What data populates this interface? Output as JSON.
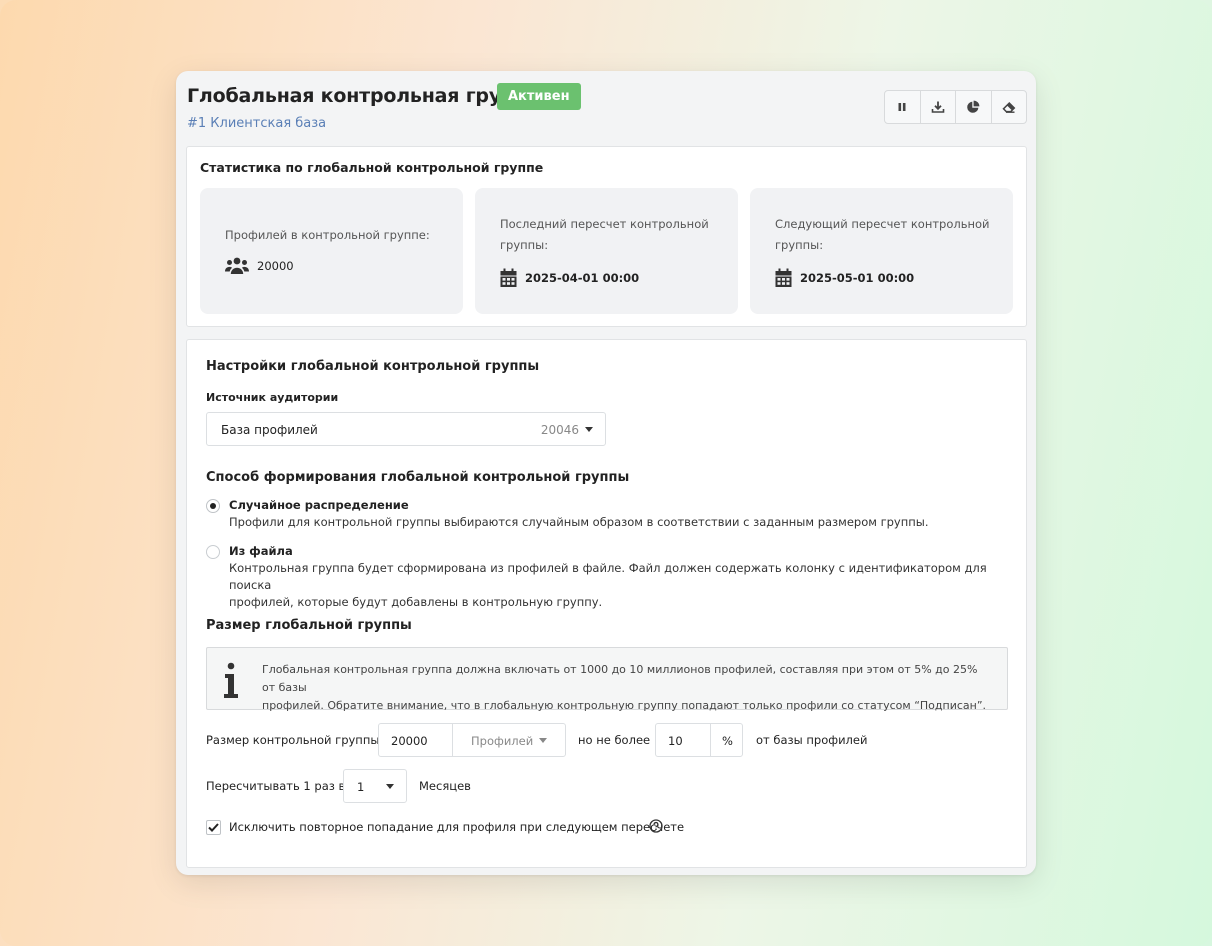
{
  "header": {
    "title": "Глобальная контрольная группа",
    "status": "Активен",
    "subtitle": "#1 Клиентская база",
    "toolbar": [
      "pause-icon",
      "download-icon",
      "pie-chart-icon",
      "eraser-icon"
    ]
  },
  "stats": {
    "title": "Статистика по глобальной контрольной группе",
    "cards": [
      {
        "label": "Профилей в контрольной группе:",
        "value": "20000",
        "icon": "users-icon"
      },
      {
        "label_line1": "Последний пересчет контрольной",
        "label_line2": "группы:",
        "value": "2025-04-01 00:00",
        "icon": "calendar-icon"
      },
      {
        "label_line1": "Следующий пересчет контрольной",
        "label_line2": "группы:",
        "value": "2025-05-01 00:00",
        "icon": "calendar-icon"
      }
    ]
  },
  "settings": {
    "title": "Настройки глобальной контрольной группы",
    "source_label": "Источник аудитории",
    "source_value": "База профилей",
    "source_count": "20046",
    "method_title": "Способ формирования глобальной контрольной группы",
    "options": [
      {
        "title": "Случайное распределение",
        "desc": "Профили для контрольной группы выбираются случайным образом в соответствии с заданным размером группы.",
        "selected": true
      },
      {
        "title": "Из файла",
        "desc_line1": "Контрольная группа будет сформирована из профилей в файле. Файл должен содержать колонку с идентификатором для поиска",
        "desc_line2": "профилей, которые будут добавлены в контрольную группу.",
        "selected": false
      }
    ],
    "size_title": "Размер глобальной группы",
    "info_line1": "Глобальная контрольная группа должна включать от 1000 до 10 миллионов профилей, составляя при этом от 5% до 25% от базы",
    "info_line2": "профилей. Обратите внимание, что в глобальную контрольную группу попадают только профили со статусом “Подписан”.",
    "size_label": "Размер контрольной группы",
    "size_value": "20000",
    "size_unit": "Профилей",
    "max_label": "но не более",
    "max_value": "10",
    "percent": "%",
    "of_base": "от базы профилей",
    "recalc_label": "Пересчитывать 1 раз в",
    "recalc_value": "1",
    "recalc_unit": "Месяцев",
    "exclude_label": "Исключить повторное попадание для профиля при следующем пересчете",
    "exclude_checked": true
  }
}
